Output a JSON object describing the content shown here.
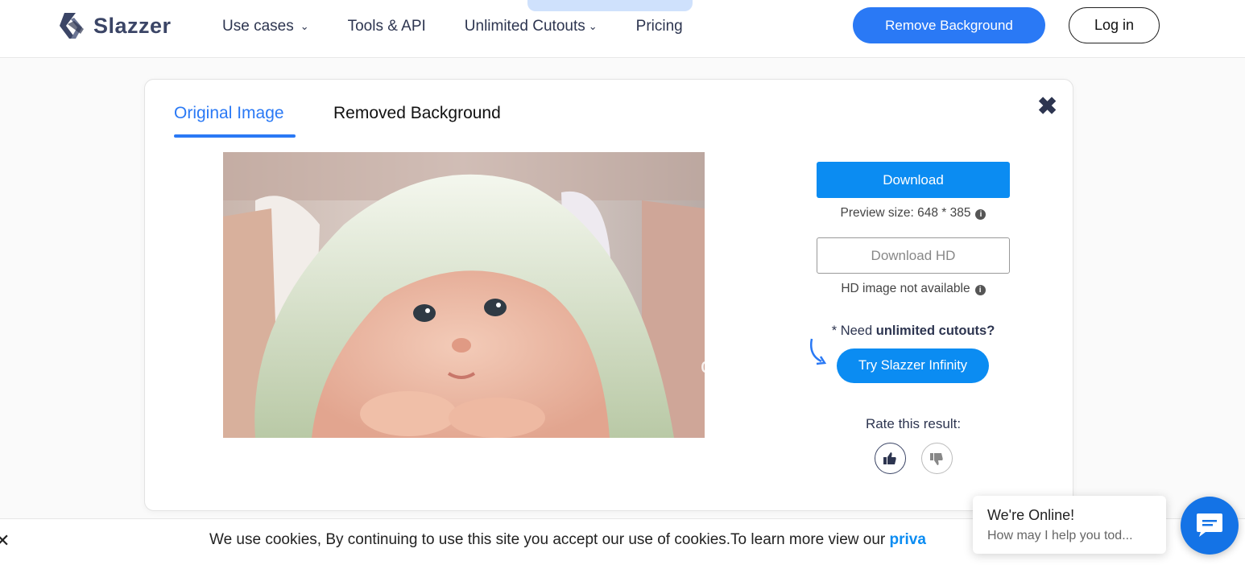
{
  "header": {
    "logo_text": "Slazzer",
    "nav": [
      {
        "label": "Use cases",
        "dropdown": true
      },
      {
        "label": "Tools & API",
        "dropdown": false
      },
      {
        "label": "Unlimited Cutouts",
        "dropdown": true
      },
      {
        "label": "Pricing",
        "dropdown": false
      }
    ],
    "remove_bg_label": "Remove Background",
    "login_label": "Log in"
  },
  "modal": {
    "tabs": [
      {
        "label": "Original Image",
        "active": true
      },
      {
        "label": "Removed Background",
        "active": false
      }
    ],
    "close_icon": "close-icon",
    "watermark": "ophone.com",
    "download_label": "Download",
    "preview_size": "Preview size: 648 * 385",
    "download_hd_label": "Download HD",
    "hd_note": "HD image not available",
    "need_prefix": "* Need ",
    "need_bold": "unlimited cutouts?",
    "try_label": "Try Slazzer Infinity",
    "rate_label": "Rate this result:"
  },
  "cookie": {
    "text": "We use cookies, By continuing to use this site you accept our use of cookies.To learn more view our ",
    "link": "priva"
  },
  "chat": {
    "title": "We're Online!",
    "subtitle": "How may I help you tod..."
  },
  "colors": {
    "primary": "#2a79f5",
    "download": "#0b8cf2",
    "text_dark": "#2d3550",
    "chat": "#1473e6"
  }
}
